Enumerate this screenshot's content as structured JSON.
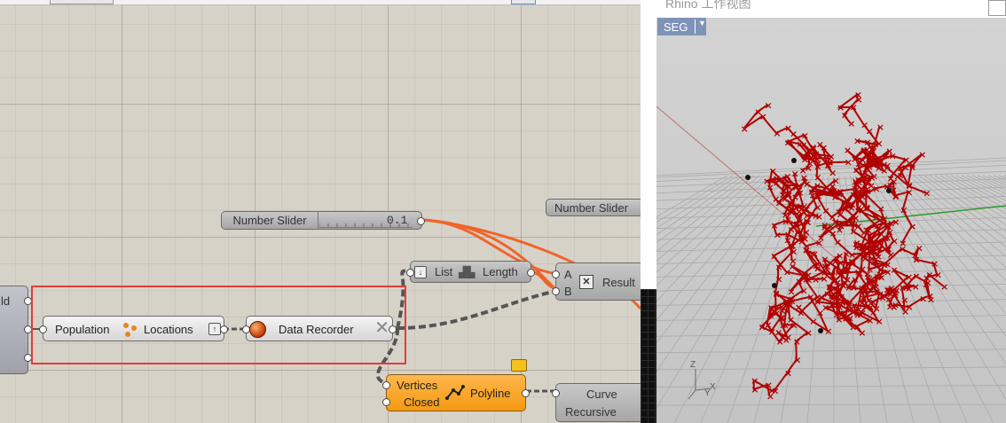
{
  "grasshopper": {
    "left_component_fragment": "ld",
    "number_slider_1": {
      "name": "Number Slider",
      "value": "0.1"
    },
    "number_slider_2": {
      "name": "Number Slider"
    },
    "list_length": {
      "input": "List",
      "output": "Length"
    },
    "result_node": {
      "input_a": "A",
      "input_b": "B",
      "output": "Result"
    },
    "population": {
      "input": "Population",
      "output": "Locations"
    },
    "data_recorder": {
      "label": "Data Recorder"
    },
    "polyline": {
      "input_vertices": "Vertices",
      "input_closed": "Closed",
      "output": "Polyline"
    },
    "curve_node": {
      "line1": "Curve",
      "line2": "Recursive"
    }
  },
  "viewport": {
    "title": "Rhino 工作视图",
    "view_name": "SEG",
    "axis_z": "Z",
    "axis_x": "X",
    "axis_y": "Y"
  },
  "colors": {
    "wire_orange": "#f0642a",
    "selection_red": "#e23c3c",
    "curve_red": "#b00000",
    "seg_button": "#7f93b8"
  }
}
